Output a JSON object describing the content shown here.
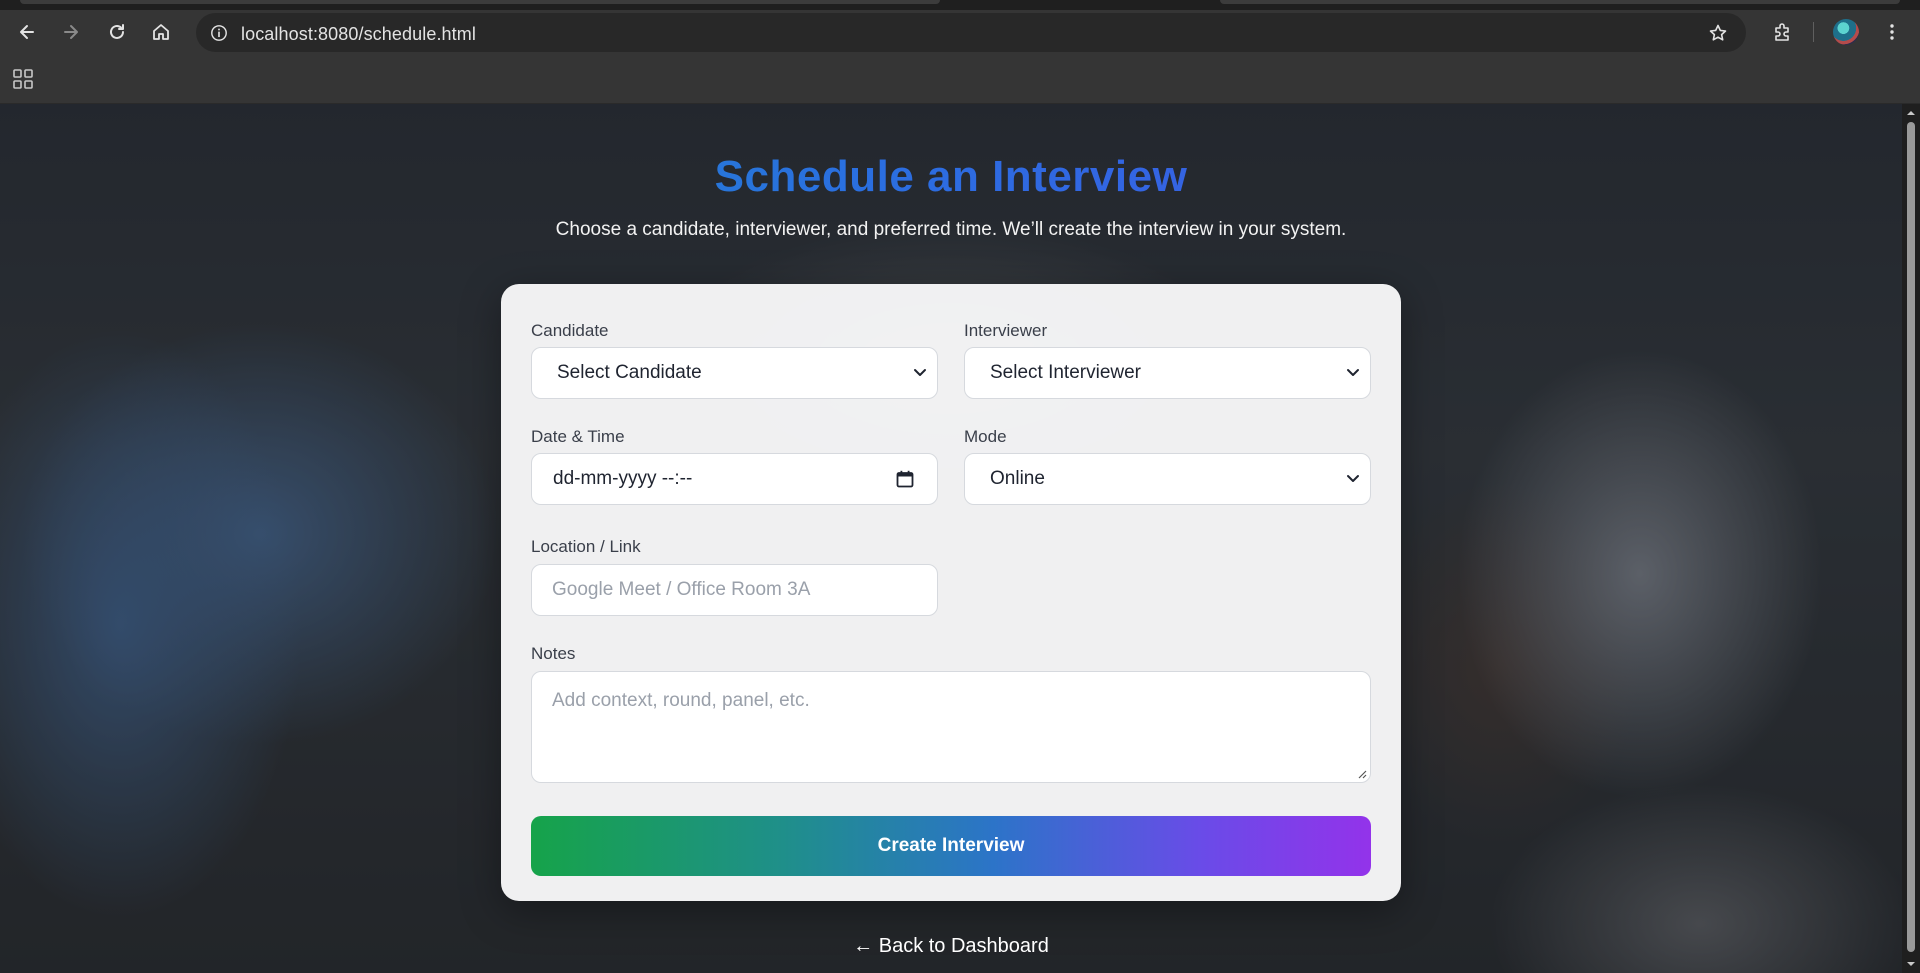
{
  "browser": {
    "url": "localhost:8080/schedule.html",
    "icons": [
      "back-icon",
      "forward-icon",
      "reload-icon",
      "home-icon",
      "site-info-icon",
      "bookmark-star-icon",
      "extensions-icon",
      "profile-avatar",
      "menu-icon",
      "apps-grid-icon"
    ]
  },
  "page": {
    "title": "Schedule an Interview",
    "subtitle": "Choose a candidate, interviewer, and preferred time. We’ll create the interview in your system.",
    "back_link": "← Back to Dashboard"
  },
  "form": {
    "candidate": {
      "label": "Candidate",
      "value": "Select Candidate"
    },
    "interviewer": {
      "label": "Interviewer",
      "value": "Select Interviewer"
    },
    "datetime": {
      "label": "Date & Time",
      "value": "dd-mm-yyyy --:--"
    },
    "mode": {
      "label": "Mode",
      "value": "Online"
    },
    "location": {
      "label": "Location / Link",
      "placeholder": "Google Meet / Office Room 3A"
    },
    "notes": {
      "label": "Notes",
      "placeholder": "Add context, round, panel, etc."
    },
    "submit_label": "Create Interview"
  },
  "colors": {
    "title_gradient": [
      "#1b95b8",
      "#2a6fe0",
      "#4b4be8"
    ],
    "button_gradient": [
      "#16a34a",
      "#2c74c8",
      "#9333ea"
    ],
    "card_bg": "#f7f7f8"
  }
}
